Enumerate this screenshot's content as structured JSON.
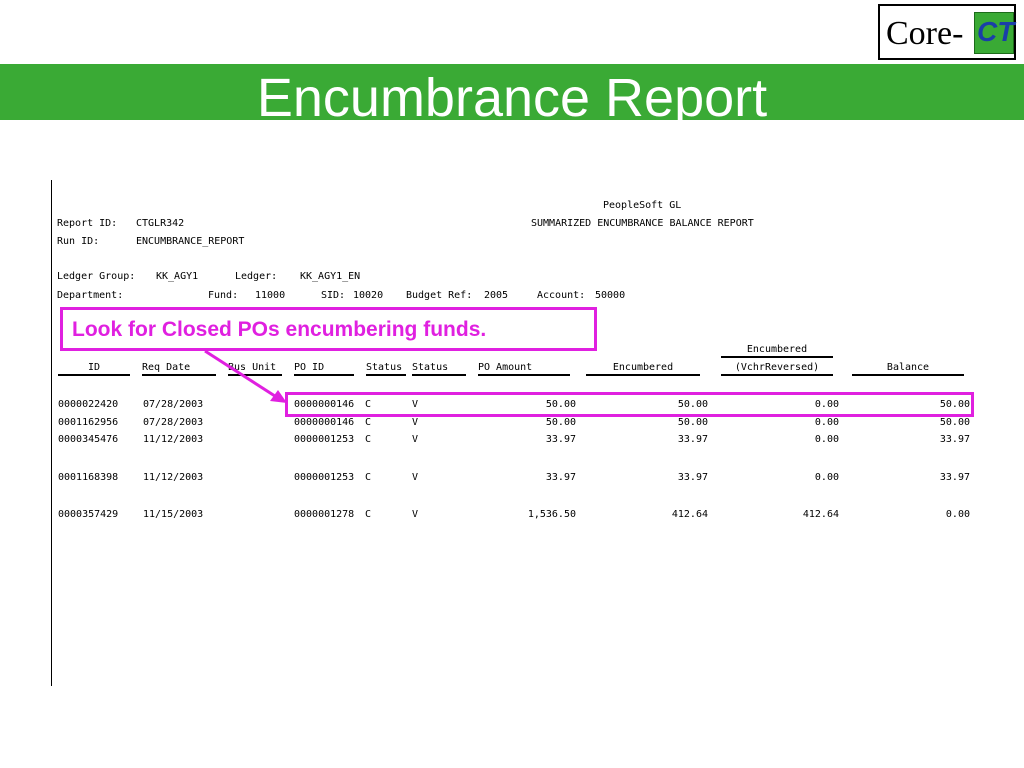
{
  "slide": {
    "title": "Encumbrance Report",
    "logo": {
      "left": "Core-",
      "right": "CT"
    }
  },
  "report": {
    "system": "PeopleSoft GL",
    "name": "SUMMARIZED ENCUMBRANCE BALANCE REPORT",
    "report_id_label": "Report ID:",
    "report_id": "CTGLR342",
    "run_id_label": "Run ID:",
    "run_id": "ENCUMBRANCE_REPORT",
    "ledger_group_label": "Ledger Group:",
    "ledger_group": "KK_AGY1",
    "ledger_label": "Ledger:",
    "ledger": "KK_AGY1_EN",
    "department_label": "Department:",
    "fund_label": "Fund:",
    "fund": "11000",
    "sid_label": "SID:",
    "sid": "10020",
    "budget_ref_label": "Budget Ref:",
    "budget_ref": "2005",
    "account_label": "Account:",
    "account": "50000",
    "header_top_encumbered": "Encumbered",
    "columns": [
      "ID",
      "Req Date",
      "Bus Unit",
      "PO ID",
      "Status",
      "Status",
      "PO Amount",
      "Encumbered",
      "(VchrReversed)",
      "Balance"
    ],
    "rows": [
      [
        "0000022420",
        "07/28/2003",
        "0000000146",
        "C",
        "V",
        "50.00",
        "50.00",
        "0.00",
        "50.00"
      ],
      [
        "0001162956",
        "07/28/2003",
        "0000000146",
        "C",
        "V",
        "50.00",
        "50.00",
        "0.00",
        "50.00"
      ],
      [
        "0000345476",
        "11/12/2003",
        "0000001253",
        "C",
        "V",
        "33.97",
        "33.97",
        "0.00",
        "33.97"
      ],
      [
        "0001168398",
        "11/12/2003",
        "0000001253",
        "C",
        "V",
        "33.97",
        "33.97",
        "0.00",
        "33.97"
      ],
      [
        "0000357429",
        "11/15/2003",
        "0000001278",
        "C",
        "V",
        "1,536.50",
        "412.64",
        "412.64",
        "0.00"
      ]
    ]
  },
  "callout": {
    "text": "Look for Closed POs encumbering funds."
  },
  "colors": {
    "banner": "#3aaa35",
    "callout": "#e020e0"
  }
}
